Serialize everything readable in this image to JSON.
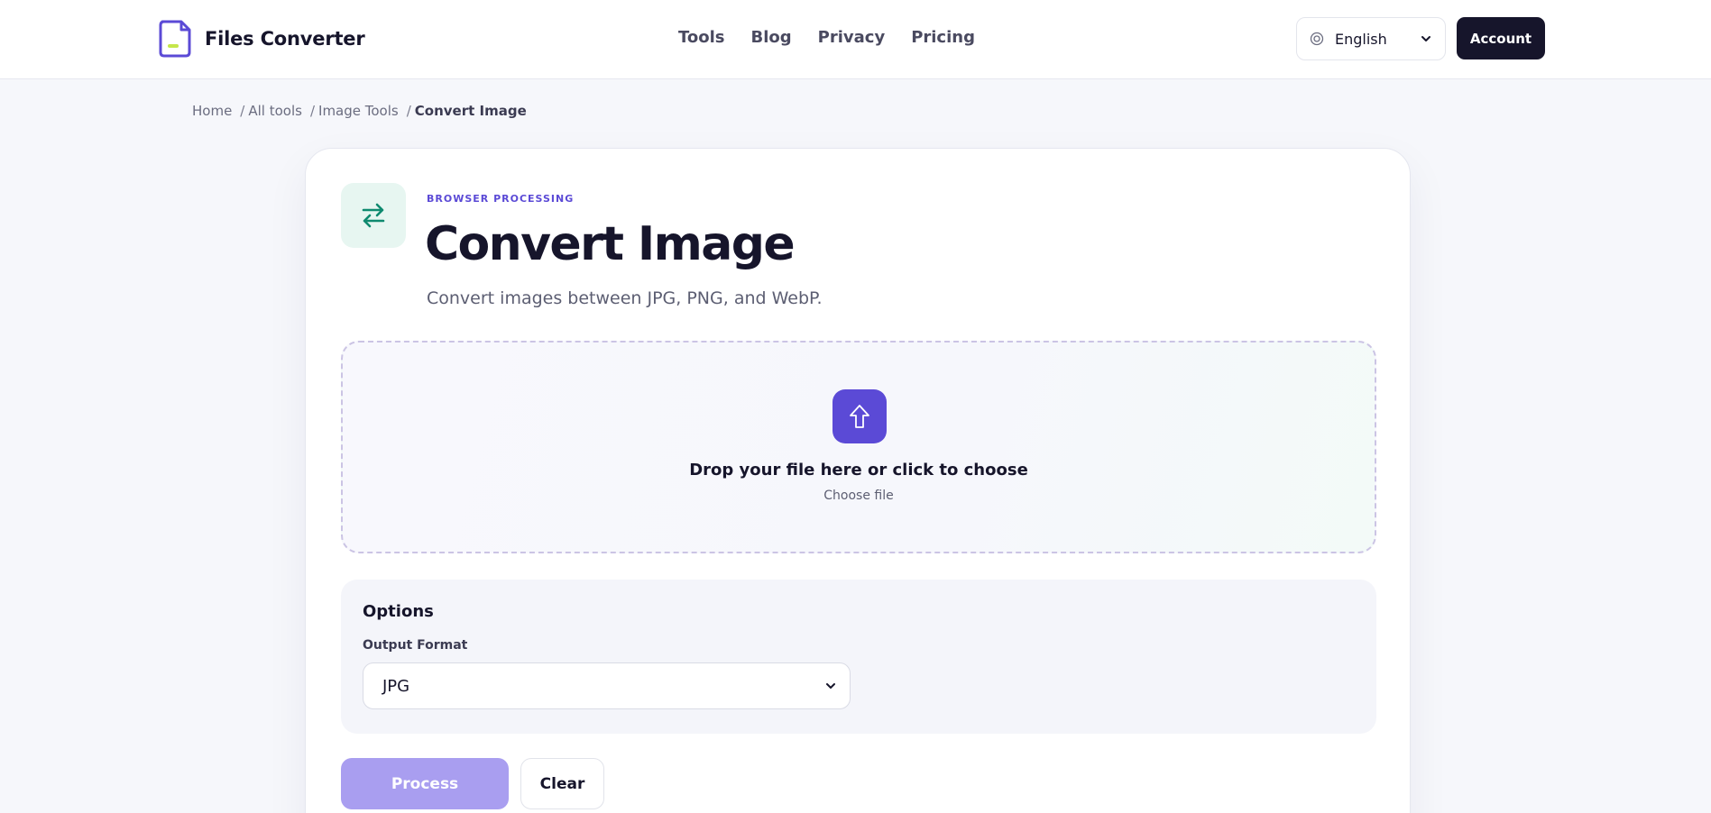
{
  "header": {
    "brand_name": "Files Converter",
    "nav": [
      "Tools",
      "Blog",
      "Privacy",
      "Pricing"
    ],
    "language": "English",
    "account_label": "Account"
  },
  "breadcrumb": {
    "items": [
      "Home",
      "All tools",
      "Image Tools"
    ],
    "separator": "/",
    "current": "Convert Image"
  },
  "tool": {
    "eyebrow": "BROWSER PROCESSING",
    "title": "Convert Image",
    "subtitle": "Convert images between JPG, PNG, and WebP."
  },
  "dropzone": {
    "title": "Drop your file here or click to choose",
    "subtitle": "Choose file"
  },
  "options": {
    "title": "Options",
    "output_format_label": "Output Format",
    "output_format_value": "JPG"
  },
  "actions": {
    "process_label": "Process",
    "clear_label": "Clear"
  },
  "icons": {
    "logo": "document-logo-icon",
    "language": "globe-icon",
    "tool": "swap-arrows-icon",
    "upload": "upload-arrow-icon",
    "chevron": "chevron-down-icon"
  },
  "colors": {
    "brand": "#5b4ad6",
    "dark": "#16152b",
    "teal": "#0f8a6f",
    "process_disabled": "#a99ef0",
    "logo_accent": "#c5e64a"
  }
}
